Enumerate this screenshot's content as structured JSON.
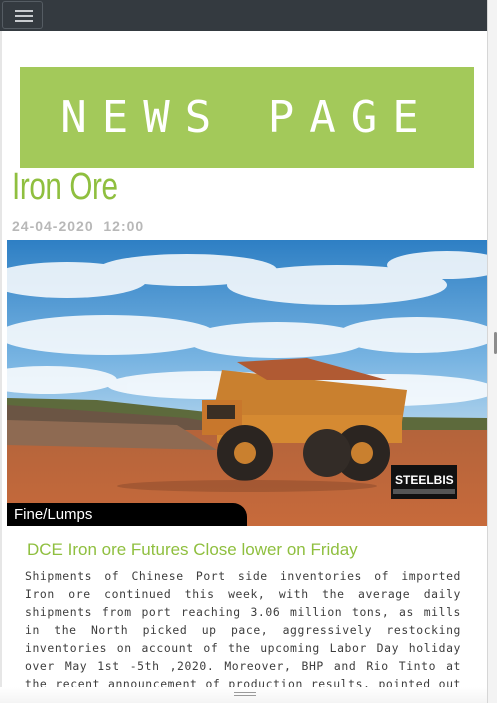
{
  "nav": {
    "menu_icon": "hamburger-icon"
  },
  "banner": {
    "text": "NEWS PAGE",
    "color": "#a3c95a"
  },
  "article": {
    "title": "Iron Ore",
    "date": "24-04-2020  12:00",
    "image": {
      "caption": "Fine/Lumps",
      "logo_text": "STEELBIS"
    },
    "headline": "DCE Iron ore Futures Close lower on Friday",
    "body": "Shipments of Chinese Port side inventories of imported Iron ore continued this week, with the average daily shipments from port reaching 3.06 million tons, as mills in the North picked up pace, aggressively restocking inventories on account of the upcoming Labor Day holiday over May 1st -5th ,2020. Moreover, BHP and Rio Tinto at the recent announcement of production results, pointed out that while"
  },
  "colors": {
    "accent": "#8fbf3f",
    "topbar": "#343a40"
  }
}
